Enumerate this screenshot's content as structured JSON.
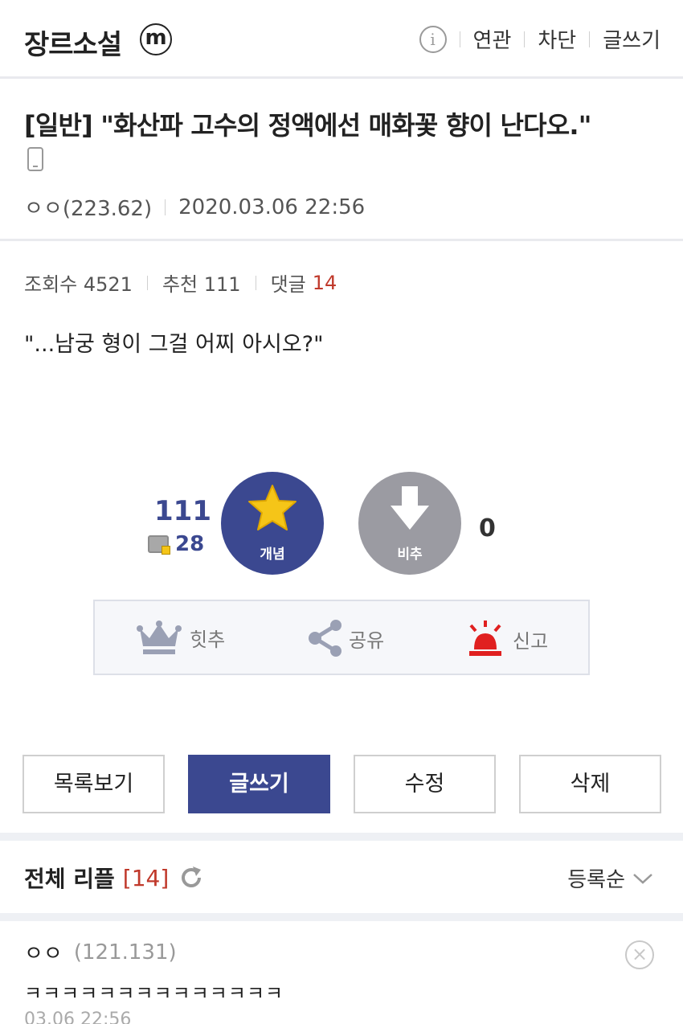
{
  "header": {
    "gallery_name": "장르소설",
    "badge": "m",
    "actions": [
      "연관",
      "차단",
      "글쓰기"
    ]
  },
  "post": {
    "title": "[일반] \"화산파 고수의 정액에선 매화꽃 향이 난다오.\"",
    "author": "ㅇㅇ(223.62)",
    "datetime": "2020.03.06 22:56",
    "views_label": "조회수 4521",
    "recommend_label": "추천 111",
    "comments_label": "댓글",
    "comments_count": "14",
    "body": "\"...남궁 형이 그걸 어찌 아시오?\""
  },
  "votes": {
    "up_count": "111",
    "fixed_count": "28",
    "up_label": "개념",
    "down_label": "비추",
    "down_count": "0"
  },
  "actions": {
    "hit": "힛추",
    "share": "공유",
    "report": "신고"
  },
  "buttons": {
    "list": "목록보기",
    "write": "글쓰기",
    "edit": "수정",
    "delete": "삭제"
  },
  "replies": {
    "title": "전체 리플",
    "count": "[14]",
    "sort": "등록순"
  },
  "comment": {
    "author": "ㅇㅇ",
    "ip": "(121.131)",
    "text": "ㅋㅋㅋㅋㅋㅋㅋㅋㅋㅋㅋㅋㅋㅋ",
    "date": "03.06 22:56"
  },
  "colors": {
    "primary": "#3b4890",
    "down": "#9b9ba2",
    "accent_red": "#c0392b",
    "star": "#f5c518"
  }
}
